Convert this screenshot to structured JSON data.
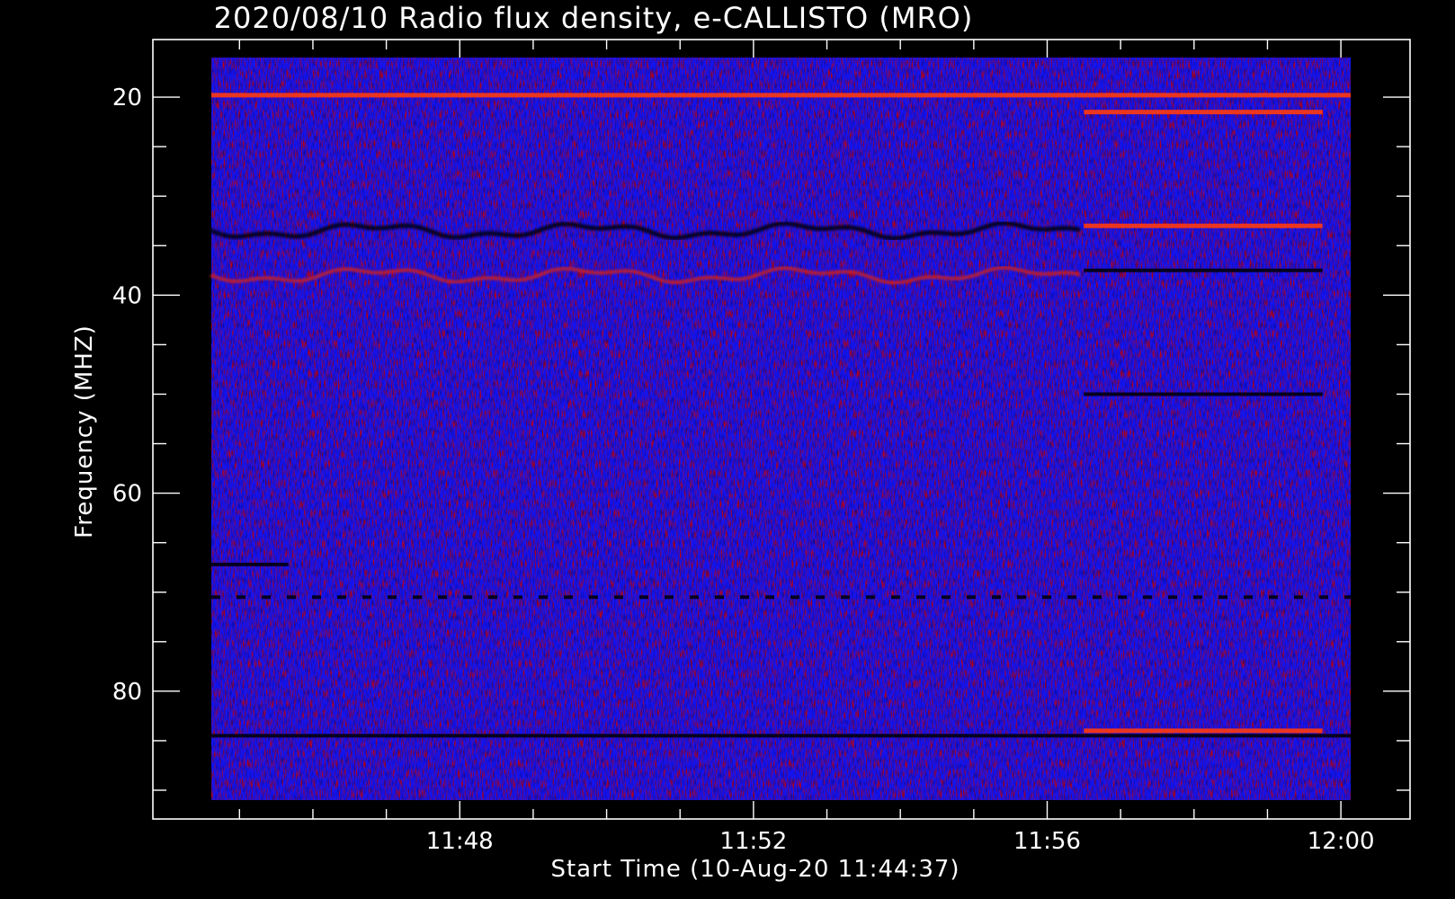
{
  "chart_data": {
    "type": "heatmap",
    "title": "2020/08/10  Radio flux density, e-CALLISTO (MRO)",
    "xlabel": "Start Time (10-Aug-20 11:44:37)",
    "ylabel": "Frequency (MHZ)",
    "x_axis": {
      "kind": "time",
      "range": [
        "11:44:37",
        "12:00:08"
      ],
      "major_ticks": [
        "11:48",
        "11:52",
        "11:56",
        "12:00"
      ],
      "minor_tick_step_minutes": 1
    },
    "y_axis": {
      "range": [
        16,
        91
      ],
      "inverted": true,
      "major_ticks": [
        20,
        40,
        60,
        80
      ],
      "minor_tick_step": 5
    },
    "colormap": [
      "#000000",
      "#0000ff",
      "#ff0000",
      "#ffff00"
    ],
    "background_color": "#000000",
    "foreground_color": "#ffffff",
    "features": [
      {
        "kind": "band",
        "freq": 19.8,
        "t_start": "11:44:37",
        "t_end": "12:00:08",
        "level": "hot"
      },
      {
        "kind": "band",
        "freq": 33.5,
        "t_start": "11:44:37",
        "t_end": "11:56:30",
        "level": "dark",
        "wavy": true
      },
      {
        "kind": "band",
        "freq": 38.0,
        "t_start": "11:44:37",
        "t_end": "11:56:30",
        "level": "warm",
        "wavy": true
      },
      {
        "kind": "band",
        "freq": 67.2,
        "t_start": "11:44:37",
        "t_end": "11:45:40",
        "level": "dark"
      },
      {
        "kind": "band",
        "freq": 70.5,
        "t_start": "11:44:37",
        "t_end": "12:00:08",
        "level": "dark",
        "dashed": true
      },
      {
        "kind": "band",
        "freq": 84.5,
        "t_start": "11:44:37",
        "t_end": "12:00:08",
        "level": "dark"
      },
      {
        "kind": "band",
        "freq": 21.5,
        "t_start": "11:56:30",
        "t_end": "11:59:45",
        "level": "hot"
      },
      {
        "kind": "band",
        "freq": 33.0,
        "t_start": "11:56:30",
        "t_end": "11:59:45",
        "level": "hot"
      },
      {
        "kind": "band",
        "freq": 37.5,
        "t_start": "11:56:30",
        "t_end": "11:59:45",
        "level": "dark"
      },
      {
        "kind": "band",
        "freq": 50.0,
        "t_start": "11:56:30",
        "t_end": "11:59:45",
        "level": "dark"
      },
      {
        "kind": "band",
        "freq": 84.0,
        "t_start": "11:56:30",
        "t_end": "11:59:45",
        "level": "hot"
      }
    ]
  }
}
